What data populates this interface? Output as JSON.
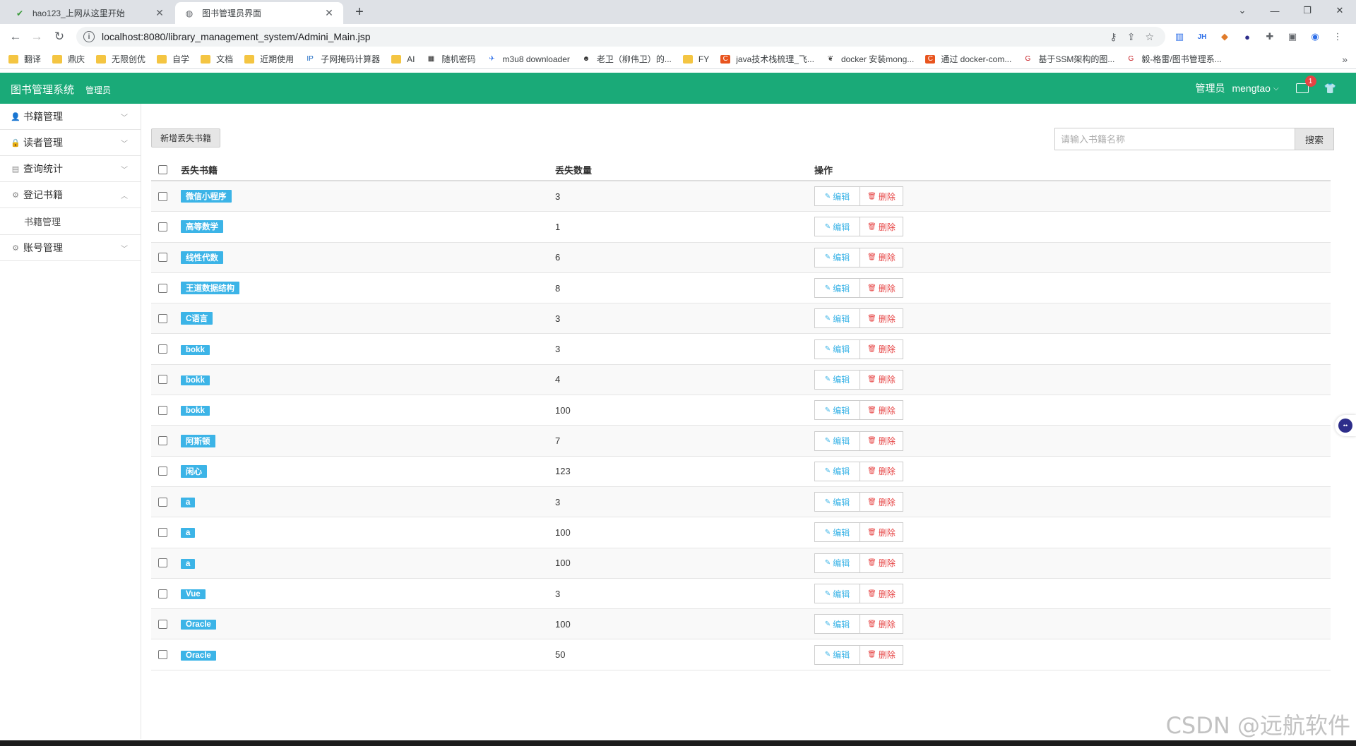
{
  "browser": {
    "tabs": [
      {
        "title": "hao123_上网从这里开始",
        "active": false
      },
      {
        "title": "图书管理员界面",
        "active": true
      }
    ],
    "url": "localhost:8080/library_management_system/Admini_Main.jsp",
    "bookmarks": [
      {
        "label": "翻译",
        "icon": "folder-icon"
      },
      {
        "label": "鼎庆",
        "icon": "folder-icon"
      },
      {
        "label": "无限创优",
        "icon": "folder-icon"
      },
      {
        "label": "自学",
        "icon": "folder-icon"
      },
      {
        "label": "文档",
        "icon": "folder-icon"
      },
      {
        "label": "近期使用",
        "icon": "folder-icon"
      },
      {
        "label": "子网掩码计算器",
        "icon": "ip-icon"
      },
      {
        "label": "AI",
        "icon": "folder-icon"
      },
      {
        "label": "随机密码",
        "icon": "key-icon"
      },
      {
        "label": "m3u8 downloader",
        "icon": "plane-icon"
      },
      {
        "label": "老卫（柳伟卫）的...",
        "icon": "avatar-icon"
      },
      {
        "label": "FY",
        "icon": "folder-icon"
      },
      {
        "label": "java技术栈梳理_飞...",
        "icon": "csdn-icon"
      },
      {
        "label": "docker 安装mong...",
        "icon": "leaf-icon"
      },
      {
        "label": "通过 docker-com...",
        "icon": "csdn-icon"
      },
      {
        "label": "基于SSM架构的图...",
        "icon": "gitee-icon"
      },
      {
        "label": "毅-格雷/图书管理系...",
        "icon": "gitee-icon"
      }
    ]
  },
  "header": {
    "title": "图书管理系统",
    "subtitle": "管理员",
    "role": "管理员",
    "username": "mengtao",
    "mail_badge": "1",
    "accent": "#1aaa78"
  },
  "sidebar": {
    "items": [
      {
        "label": "书籍管理",
        "icon": "user-icon",
        "expanded": false
      },
      {
        "label": "读者管理",
        "icon": "lock-icon",
        "expanded": false
      },
      {
        "label": "查询统计",
        "icon": "chart-icon",
        "expanded": false
      },
      {
        "label": "登记书籍",
        "icon": "gear-icon",
        "expanded": true
      },
      {
        "label": "书籍管理",
        "icon": "",
        "submenu": true
      },
      {
        "label": "账号管理",
        "icon": "gear-icon",
        "expanded": false
      }
    ]
  },
  "toolbar": {
    "add_label": "新增丢失书籍",
    "search_placeholder": "请输入书籍名称",
    "search_label": "搜索"
  },
  "table": {
    "headers": [
      "丢失书籍",
      "丢失数量",
      "操作"
    ],
    "edit_label": "编辑",
    "delete_label": "删除",
    "rows": [
      {
        "book": "微信小程序",
        "qty": "3"
      },
      {
        "book": "高等数学",
        "qty": "1"
      },
      {
        "book": "线性代数",
        "qty": "6"
      },
      {
        "book": "王道数据结构",
        "qty": "8"
      },
      {
        "book": "C语言",
        "qty": "3"
      },
      {
        "book": "bokk",
        "qty": "3"
      },
      {
        "book": "bokk",
        "qty": "4"
      },
      {
        "book": "bokk",
        "qty": "100"
      },
      {
        "book": "阿斯顿",
        "qty": "7"
      },
      {
        "book": "闲心",
        "qty": "123"
      },
      {
        "book": "a",
        "qty": "3"
      },
      {
        "book": "a",
        "qty": "100"
      },
      {
        "book": "a",
        "qty": "100"
      },
      {
        "book": "Vue",
        "qty": "3"
      },
      {
        "book": "Oracle",
        "qty": "100"
      },
      {
        "book": "Oracle",
        "qty": "50"
      }
    ]
  },
  "watermark": "CSDN @远航软件"
}
